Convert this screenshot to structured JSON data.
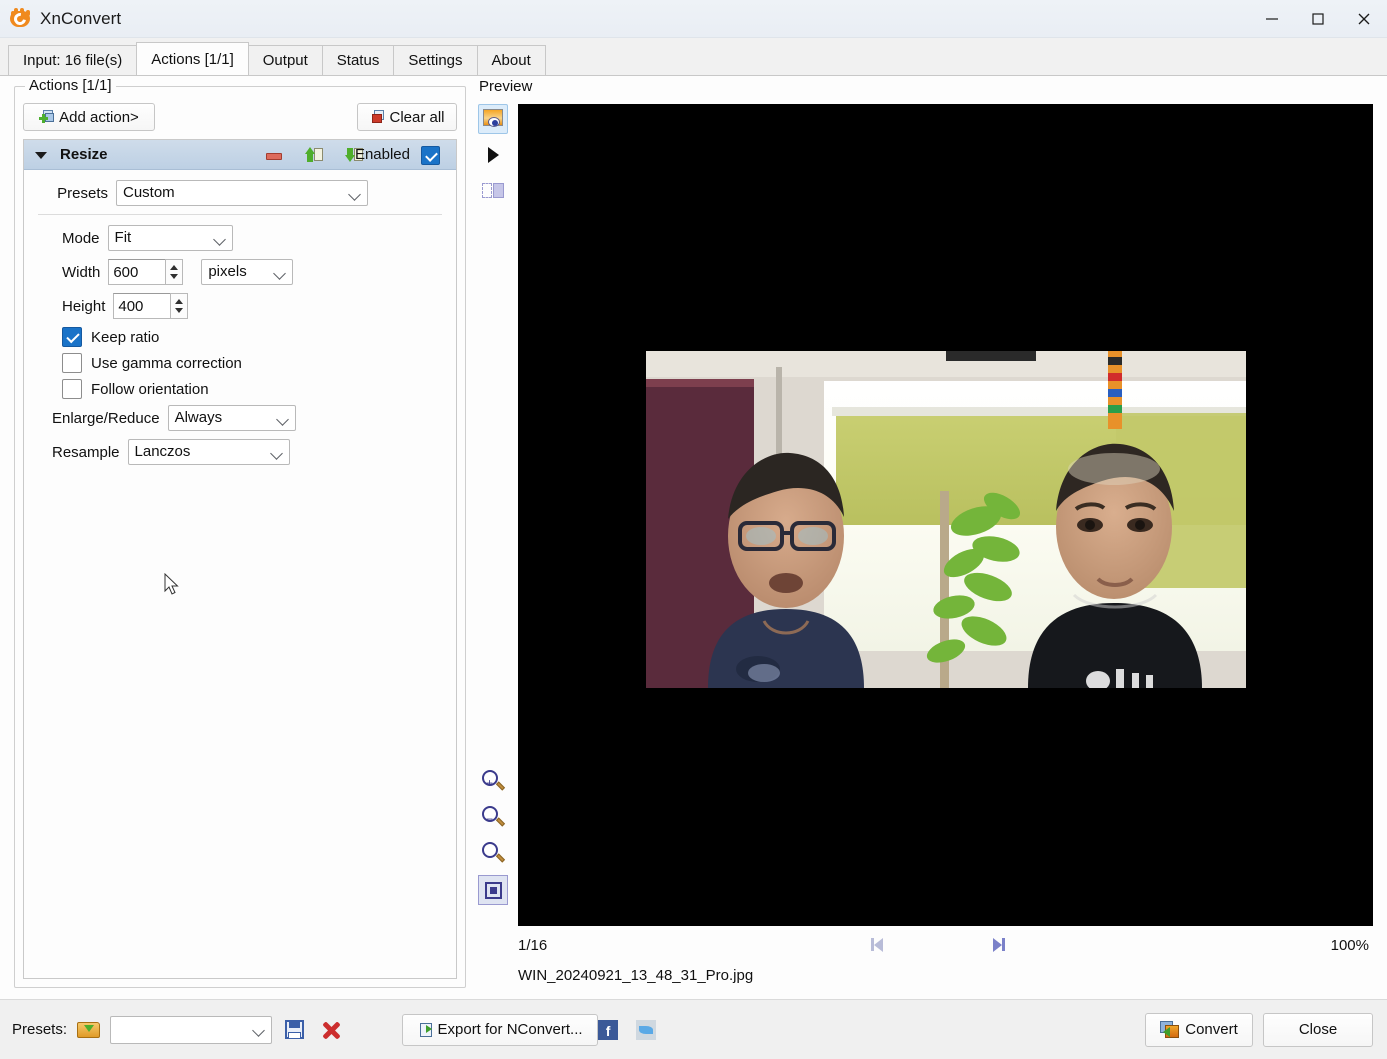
{
  "window": {
    "title": "XnConvert",
    "app_icon": "xnconvert-logo-icon",
    "minimize_label": "—",
    "maximize_label": "☐",
    "close_label": "✕"
  },
  "tabs": [
    {
      "label": "Input: 16 file(s)",
      "active": false
    },
    {
      "label": "Actions [1/1]",
      "active": true
    },
    {
      "label": "Output",
      "active": false
    },
    {
      "label": "Status",
      "active": false
    },
    {
      "label": "Settings",
      "active": false
    },
    {
      "label": "About",
      "active": false
    }
  ],
  "actions_panel": {
    "legend": "Actions [1/1]",
    "add_action_label": "Add action>",
    "clear_all_label": "Clear all",
    "action": {
      "title": "Resize",
      "enabled_label": "Enabled",
      "enabled_checked": true,
      "presets_label": "Presets",
      "presets_value": "Custom",
      "mode_label": "Mode",
      "mode_value": "Fit",
      "width_label": "Width",
      "width_value": "600",
      "unit_value": "pixels",
      "height_label": "Height",
      "height_value": "400",
      "keep_ratio_label": "Keep ratio",
      "keep_ratio_checked": true,
      "gamma_label": "Use gamma correction",
      "gamma_checked": false,
      "orientation_label": "Follow orientation",
      "orientation_checked": false,
      "enlarge_label": "Enlarge/Reduce",
      "enlarge_value": "Always",
      "resample_label": "Resample",
      "resample_value": "Lanczos"
    }
  },
  "preview": {
    "legend": "Preview",
    "tools": [
      "preview-image-icon",
      "play-icon",
      "split-view-icon"
    ],
    "zoom_tools": [
      "zoom-in-icon",
      "zoom-out-icon",
      "zoom-actual-icon",
      "zoom-fit-icon"
    ],
    "index": "1/16",
    "zoom_level": "100%",
    "filename": "WIN_20240921_13_48_31_Pro.jpg",
    "background_color": "#000000"
  },
  "bottom_bar": {
    "presets_label": "Presets:",
    "presets_value": "",
    "presets_placeholder": "",
    "export_label": "Export for NConvert...",
    "convert_label": "Convert",
    "close_label": "Close"
  }
}
